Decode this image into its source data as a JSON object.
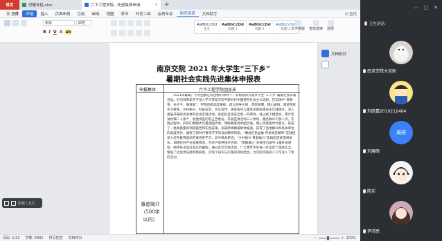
{
  "tabs": [
    {
      "label": "首页",
      "kind": "home"
    },
    {
      "label": "供暖补贴.xlsx",
      "kind": "file"
    },
    {
      "label": "六下工程学院...先进集体申请",
      "kind": "active"
    }
  ],
  "menu": {
    "file": "三 文件",
    "items": [
      "开始",
      "插入",
      "页面布局",
      "引用",
      "审阅",
      "视图",
      "章节",
      "开发工具",
      "会员专享",
      "稻壳资源",
      "文档助手"
    ],
    "active_index": 9,
    "search": "Q 查找"
  },
  "ribbon": {
    "font_name": "宋体",
    "font_size": "四号",
    "styles": [
      {
        "preview": "AaBbCcDd",
        "label": "正文"
      },
      {
        "preview": "AaBbCcDd",
        "label": "标题 1"
      },
      {
        "preview": "AaBbCcDd",
        "label": "标题 2"
      },
      {
        "preview": "AaBbCcDd",
        "label": "标题 3"
      }
    ],
    "text_tool": "文字排版",
    "find_replace": "查找替换",
    "select": "选择"
  },
  "document": {
    "title": "南京交院 2021 年大学生“三下乡”",
    "subtitle": "暑期社会实践先进集体申报表",
    "table": {
      "row1_label": "申报集体",
      "row1_value": "六下工程学院团总支",
      "intro_label": "事迹简介（500字以内）"
    },
    "body": "2021年暑期，学院团委在校团委的领导下，积极组织开展大学生“三下乡”暑期社会实践活动。为引领青年学子深入学习贯彻习近平新时代中国特色社会主义思想，在实践中“受教育、长才干、做贡献”，学院团委高度重视，成立领导小组，周密部署，精心安排，围绕党史学习教育、乡村振兴、科技支农、文化宣传、关爱留守儿童等主题组建多支实践团队，深入基层开展形式多样的社会实践活动。各团队坚持安全第一的原则，线上线下相结合，累计走访村镇二十余个，发放调查问卷五百余份，开展宣讲活动三十余场，服务群众千余人次。实践过程中，同学们用脚步丈量祖国大地，用眼睛发现中国实践，用心灵感悟时代变迁，形成了一批高质量的调研报告和实践成果，多篇新闻稿被媒体报道，获得了当地群众和有关单位的高度评价，展现了新时代青年学子的良好精神风貌。“赓续红色血脉 传承党史精神”实践团深入红色教育基地开展党史学习，追寻革命足迹；“乡村振兴 青春助力”实践团走进田间地头，调研农村产业发展情况，为农户提供技术咨询；“情暖童心”支教团为留守儿童开设课程，陪伴孩子度过充实的暑假。通过此次实践活动，广大青年学生进一步坚定了理想信念，增强了社会责任感和使命感，实现了知识与实践的有机结合，为学院实践育人工作注入了新的活力。"
  },
  "doc_tools": {
    "label": "文档校对"
  },
  "float_tools": {
    "label": "隐藏工具栏"
  },
  "status": {
    "page": "页码: 1/22",
    "words": "字数: 6882",
    "spell": "拼写检查",
    "doc_check": "文档校对",
    "zoom": "100%"
  },
  "panel": {
    "speaking_label": "正在讲话:",
    "participants": [
      {
        "name": "南京交院大吉助",
        "avatar": "cat"
      },
      {
        "name": "刘跃嘉2010212404",
        "avatar": "cartoon"
      },
      {
        "name": "刘展硕",
        "avatar": "blue",
        "initials": "展硕"
      },
      {
        "name": "陈实",
        "avatar": "anime"
      },
      {
        "name": "尹鸿亮",
        "avatar": "anime2"
      }
    ]
  },
  "colors": {
    "accent": "#2f6fd6",
    "home": "#d23b2e",
    "panel_bg": "#2b2e33"
  }
}
